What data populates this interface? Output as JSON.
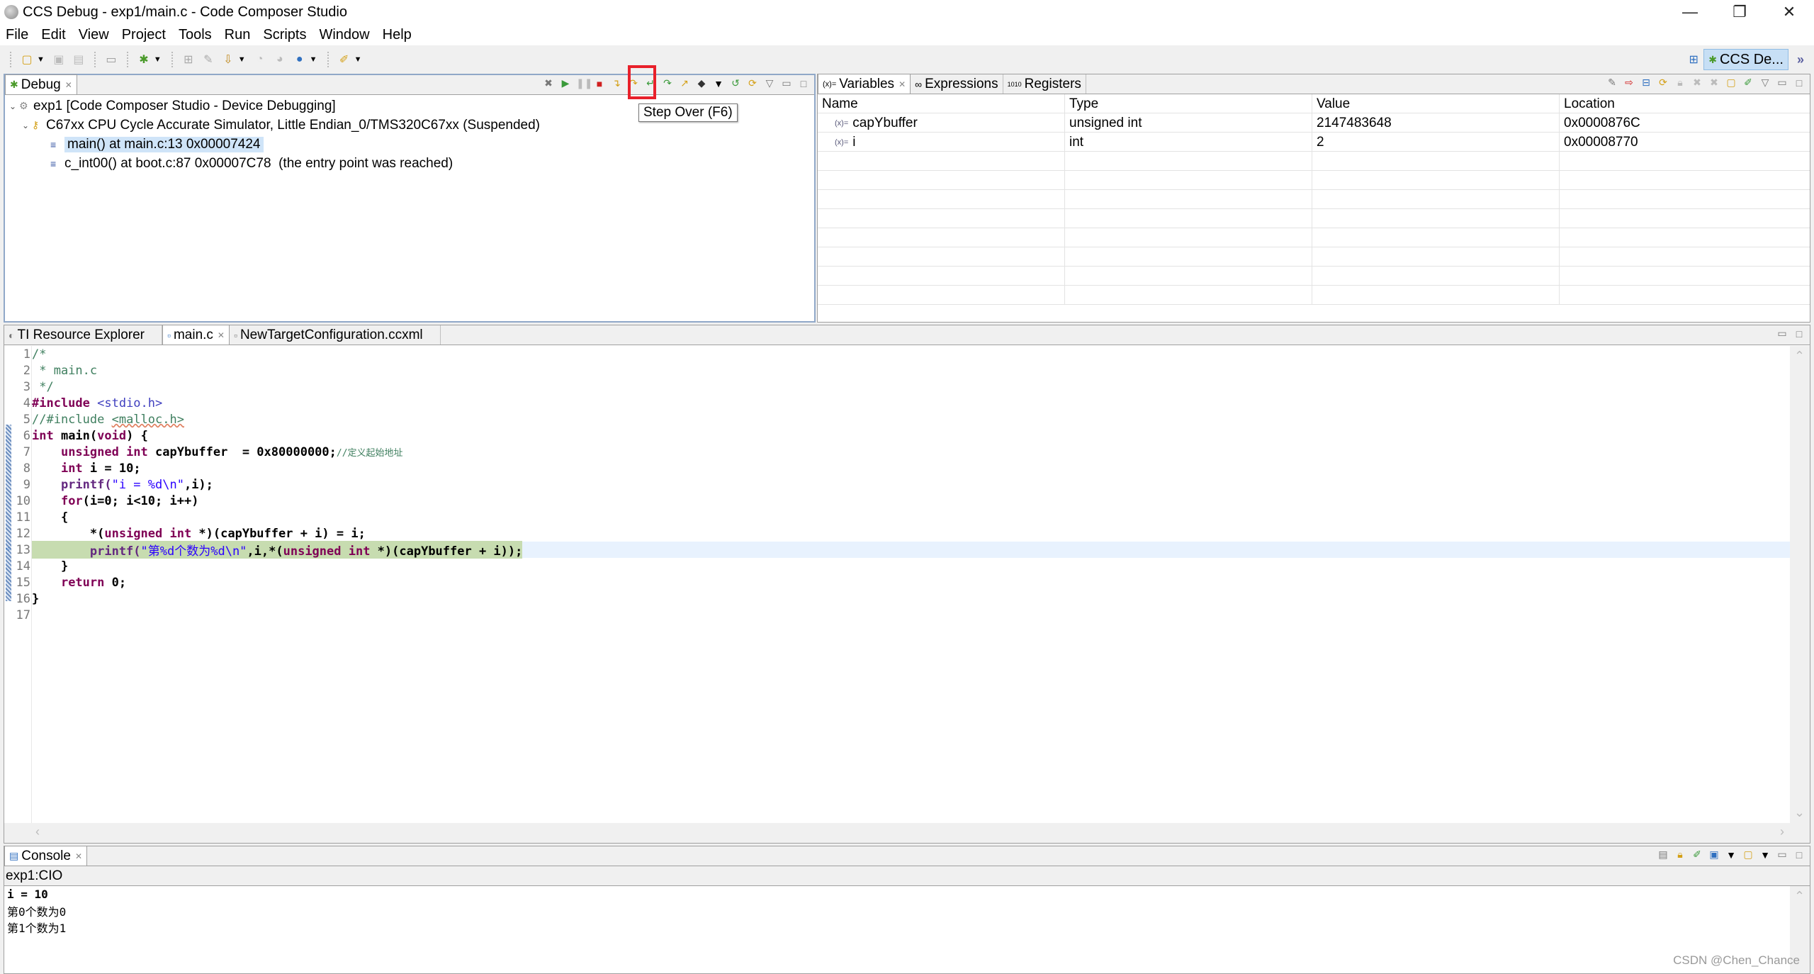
{
  "window": {
    "title": "CCS Debug - exp1/main.c - Code Composer Studio",
    "controls": {
      "minimize": "—",
      "restore": "❐",
      "close": "✕"
    }
  },
  "menu": [
    "File",
    "Edit",
    "View",
    "Project",
    "Tools",
    "Run",
    "Scripts",
    "Window",
    "Help"
  ],
  "perspective": {
    "label": "CCS De...",
    "more": "»"
  },
  "debug_view": {
    "tab_label": "Debug",
    "tooltip": "Step Over (F6)",
    "tree": [
      {
        "label": "exp1 [Code Composer Studio - Device Debugging]"
      },
      {
        "label": "C67xx CPU Cycle Accurate Simulator, Little Endian_0/TMS320C67xx (Suspended)"
      },
      {
        "label": "main() at main.c:13 0x00007424"
      },
      {
        "label": "c_int00() at boot.c:87 0x00007C78  (the entry point was reached)"
      }
    ]
  },
  "variables_view": {
    "tabs": [
      "Variables",
      "Expressions",
      "Registers"
    ],
    "columns": [
      "Name",
      "Type",
      "Value",
      "Location"
    ],
    "rows": [
      {
        "name": "capYbuffer",
        "type": "unsigned int",
        "value": "2147483648",
        "location": "0x0000876C"
      },
      {
        "name": "i",
        "type": "int",
        "value": "2",
        "location": "0x00008770"
      }
    ]
  },
  "editor": {
    "tabs": [
      "TI Resource Explorer",
      "main.c",
      "NewTargetConfiguration.ccxml"
    ],
    "current_line": 13,
    "lines": [
      {
        "n": "1"
      },
      {
        "n": "2"
      },
      {
        "n": "3"
      },
      {
        "n": "4"
      },
      {
        "n": "5"
      },
      {
        "n": "6"
      },
      {
        "n": "7"
      },
      {
        "n": "8"
      },
      {
        "n": "9"
      },
      {
        "n": "10"
      },
      {
        "n": "11"
      },
      {
        "n": "12"
      },
      {
        "n": "13"
      },
      {
        "n": "14"
      },
      {
        "n": "15"
      },
      {
        "n": "16"
      },
      {
        "n": "17"
      }
    ],
    "tokens": {
      "l1": "/*",
      "l2": " * main.c",
      "l3": " */",
      "l4a": "#include",
      "l4b": " <stdio.h>",
      "l5a": "//#include ",
      "l5b": "<malloc.h>",
      "l6a": "int",
      "l6b": " main(",
      "l6c": "void",
      "l6d": ") {",
      "l7a": "    ",
      "l7b": "unsigned int",
      "l7c": " capYbuffer  = 0x80000000;",
      "l7d": "//定义起始地址",
      "l8a": "    ",
      "l8b": "int",
      "l8c": " i = 10;",
      "l9a": "    printf(",
      "l9b": "\"i = %d\\n\"",
      "l9c": ",i);",
      "l10a": "    ",
      "l10b": "for",
      "l10c": "(i=0; i<10; i++)",
      "l11": "    {",
      "l12a": "        *(",
      "l12b": "unsigned int",
      "l12c": " *)(capYbuffer + i) = i;",
      "l13a": "        printf(",
      "l13b": "\"第%d个数为%d\\n\"",
      "l13c": ",i,*(",
      "l13d": "unsigned int",
      "l13e": " *)(capYbuffer + i));",
      "l14": "    }",
      "l15a": "    ",
      "l15b": "return",
      "l15c": " 0;",
      "l16": "}",
      "l17": ""
    }
  },
  "console": {
    "tab_label": "Console",
    "source": "exp1:CIO",
    "lines": [
      "i = 10",
      "第0个数为0",
      "第1个数为1"
    ]
  },
  "watermark": "CSDN @Chen_Chance"
}
